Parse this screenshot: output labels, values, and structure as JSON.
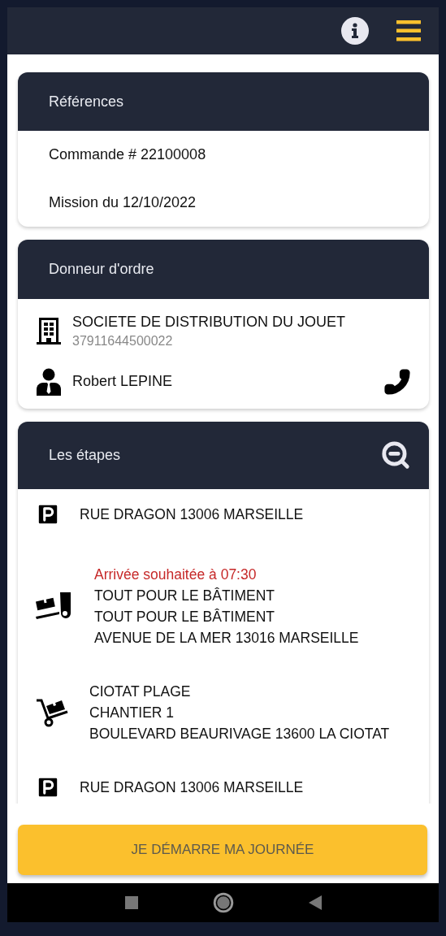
{
  "references": {
    "title": "Références",
    "lines": [
      "Commande # 22100008",
      "Mission du 12/10/2022"
    ]
  },
  "donneur": {
    "title": "Donneur d'ordre",
    "company": "SOCIETE DE DISTRIBUTION DU JOUET",
    "company_id": "37911644500022",
    "contact": "Robert LEPINE"
  },
  "etapes": {
    "title": "Les étapes",
    "steps": [
      {
        "kind": "parking",
        "lines": [
          "RUE DRAGON 13006 MARSEILLE"
        ]
      },
      {
        "kind": "delivery",
        "note": "Arrivée souhaitée à 07:30",
        "lines": [
          "TOUT POUR LE BÂTIMENT",
          "TOUT POUR LE BÂTIMENT",
          "AVENUE DE LA MER 13016 MARSEILLE"
        ]
      },
      {
        "kind": "pickup",
        "lines": [
          "CIOTAT PLAGE",
          "CHANTIER 1",
          "BOULEVARD BEAURIVAGE 13600 LA CIOTAT"
        ]
      },
      {
        "kind": "parking",
        "lines": [
          "RUE DRAGON 13006 MARSEILLE"
        ]
      }
    ]
  },
  "start_button": "JE DÉMARRE MA JOURNÉE"
}
